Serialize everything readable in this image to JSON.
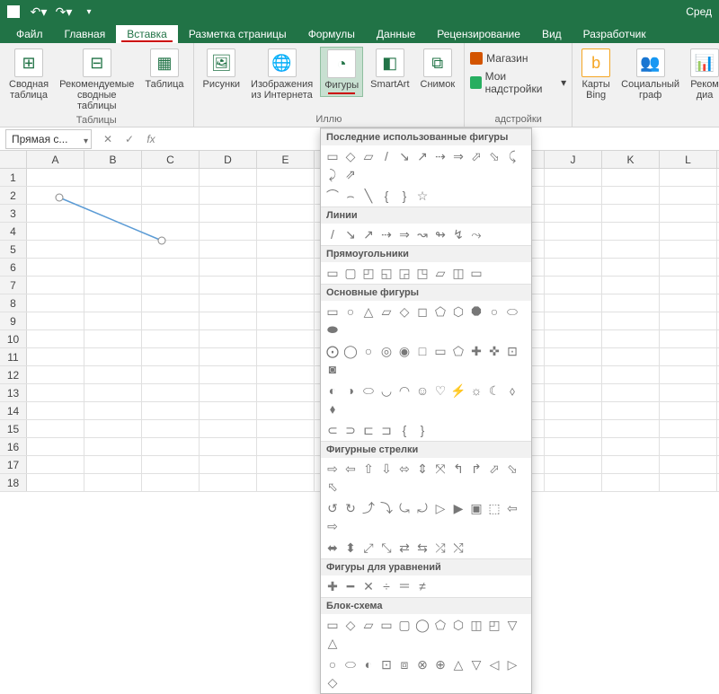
{
  "titlebar": {
    "right_status": "Сред"
  },
  "tabs": {
    "file": "Файл",
    "home": "Главная",
    "insert": "Вставка",
    "page_layout": "Разметка страницы",
    "formulas": "Формулы",
    "data": "Данные",
    "review": "Рецензирование",
    "view": "Вид",
    "developer": "Разработчик"
  },
  "ribbon": {
    "tables": {
      "pivot": "Сводная\nтаблица",
      "recommended": "Рекомендуемые\nсводные таблицы",
      "table": "Таблица",
      "caption": "Таблицы"
    },
    "illustrations": {
      "pictures": "Рисунки",
      "online": "Изображения\nиз Интернета",
      "shapes": "Фигуры",
      "smartart": "SmartArt",
      "screenshot": "Снимок",
      "caption": "Иллю"
    },
    "addins": {
      "store": "Магазин",
      "myaddins": "Мои надстройки",
      "caption": "адстройки"
    },
    "maps": {
      "bing": "Карты\nBing",
      "people": "Социальный\nграф",
      "rec": "Реком\nдиа"
    }
  },
  "namebox": "Прямая с...",
  "fx_label": "fx",
  "columns": [
    "A",
    "B",
    "C",
    "D",
    "E",
    "",
    "",
    "",
    "",
    "J",
    "K",
    "L"
  ],
  "row_count": 18,
  "shapes_panel": {
    "recent": "Последние использованные фигуры",
    "lines": "Линии",
    "rects": "Прямоугольники",
    "basic": "Основные фигуры",
    "arrows": "Фигурные стрелки",
    "equation": "Фигуры для уравнений",
    "flowchart": "Блок-схема",
    "icons_recent": [
      "▭",
      "◇",
      "▱",
      "/",
      "↘",
      "↗",
      "⇢",
      "⇒",
      "⬀",
      "⬂",
      "⤹",
      "⤸",
      "⇗"
    ],
    "icons_recent2": [
      "⌒",
      "⌢",
      "╲",
      "{",
      "}",
      "☆"
    ],
    "icons_lines": [
      "/",
      "↘",
      "↗",
      "⇢",
      "⇒",
      "↝",
      "↬",
      "↯",
      "⤳"
    ],
    "icons_rects": [
      "▭",
      "▢",
      "◰",
      "◱",
      "◲",
      "◳",
      "▱",
      "◫",
      "▭"
    ],
    "icons_basic1": [
      "▭",
      "○",
      "△",
      "▱",
      "◇",
      "◻",
      "⬠",
      "⬡",
      "⯃",
      "○",
      "⬭",
      "⬬"
    ],
    "icons_basic2": [
      "⨀",
      "◯",
      "○",
      "◎",
      "◉",
      "□",
      "▭",
      "⬠",
      "✚",
      "✜",
      "⊡",
      "◙"
    ],
    "icons_basic3": [
      "◐",
      "◑",
      "⬭",
      "◡",
      "◠",
      "☺",
      "♡",
      "⚡",
      "☼",
      "☾",
      "⬨",
      "⬧"
    ],
    "icons_basic4": [
      "⊂",
      "⊃",
      "⊏",
      "⊐",
      "{",
      "}"
    ],
    "icons_arrows1": [
      "⇨",
      "⇦",
      "⇧",
      "⇩",
      "⬄",
      "⇕",
      "⤧",
      "↰",
      "↱",
      "⬀",
      "⬂",
      "⬁"
    ],
    "icons_arrows2": [
      "↺",
      "↻",
      "⤴",
      "⤵",
      "⤿",
      "⤾",
      "▷",
      "▶",
      "▣",
      "⬚",
      "⇦",
      "⇨"
    ],
    "icons_arrows3": [
      "⬌",
      "⬍",
      "⤢",
      "⤡",
      "⇄",
      "⇆",
      "⤮",
      "⤭"
    ],
    "icons_eq": [
      "✚",
      "━",
      "✕",
      "÷",
      "＝",
      "≠"
    ],
    "icons_flow1": [
      "▭",
      "◇",
      "▱",
      "▭",
      "▢",
      "◯",
      "⬠",
      "⬡",
      "◫",
      "◰",
      "▽",
      "△"
    ],
    "icons_flow2": [
      "○",
      "⬭",
      "◐",
      "⊡",
      "⧈",
      "⊗",
      "⊕",
      "△",
      "▽",
      "◁",
      "▷",
      "◇"
    ]
  }
}
